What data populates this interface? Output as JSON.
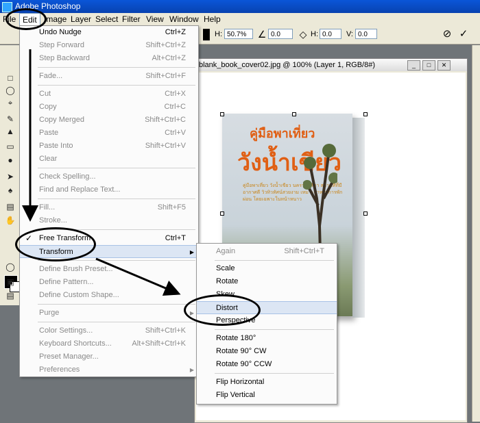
{
  "app": {
    "title": "Adobe Photoshop"
  },
  "menubar": [
    "File",
    "Edit",
    "Image",
    "Layer",
    "Select",
    "Filter",
    "View",
    "Window",
    "Help"
  ],
  "options": {
    "h_label": "H:",
    "h_value": "50.7%",
    "angle_value": "0.0",
    "hskew_label": "H:",
    "hskew_value": "0.0",
    "vskew_label": "V:",
    "vskew_value": "0.0"
  },
  "document": {
    "title": "blank_book_cover02.jpg @ 100% (Layer 1, RGB/8#)"
  },
  "book": {
    "title1": "คู่มือพาเที่ยว",
    "title2": "วังน้ำเขียว",
    "subtitle": "คู่มือพาเที่ยว วังน้ำเขียว นครราชสีมา สถานที่ที่มีอากาศดี วิวทิวทัศน์สวยงาม เหมาะสำหรับการพักผ่อน โดยเฉพาะในหน้าหนาว"
  },
  "edit_menu": [
    {
      "label": "Undo Nudge",
      "shortcut": "Ctrl+Z",
      "disabled": false
    },
    {
      "label": "Step Forward",
      "shortcut": "Shift+Ctrl+Z",
      "disabled": true
    },
    {
      "label": "Step Backward",
      "shortcut": "Alt+Ctrl+Z",
      "disabled": true
    },
    {
      "label": "Fade...",
      "shortcut": "Shift+Ctrl+F",
      "disabled": true
    },
    {
      "label": "Cut",
      "shortcut": "Ctrl+X",
      "disabled": true
    },
    {
      "label": "Copy",
      "shortcut": "Ctrl+C",
      "disabled": true
    },
    {
      "label": "Copy Merged",
      "shortcut": "Shift+Ctrl+C",
      "disabled": true
    },
    {
      "label": "Paste",
      "shortcut": "Ctrl+V",
      "disabled": true
    },
    {
      "label": "Paste Into",
      "shortcut": "Shift+Ctrl+V",
      "disabled": true
    },
    {
      "label": "Clear",
      "shortcut": "",
      "disabled": true
    },
    {
      "label": "Check Spelling...",
      "shortcut": "",
      "disabled": true
    },
    {
      "label": "Find and Replace Text...",
      "shortcut": "",
      "disabled": true
    },
    {
      "label": "Fill...",
      "shortcut": "Shift+F5",
      "disabled": true
    },
    {
      "label": "Stroke...",
      "shortcut": "",
      "disabled": true
    },
    {
      "label": "Free Transform",
      "shortcut": "Ctrl+T",
      "disabled": false,
      "checked": true
    },
    {
      "label": "Transform",
      "shortcut": "",
      "disabled": false,
      "submenu": true
    },
    {
      "label": "Define Brush Preset...",
      "shortcut": "",
      "disabled": true
    },
    {
      "label": "Define Pattern...",
      "shortcut": "",
      "disabled": true
    },
    {
      "label": "Define Custom Shape...",
      "shortcut": "",
      "disabled": true
    },
    {
      "label": "Purge",
      "shortcut": "",
      "disabled": true,
      "submenu": true
    },
    {
      "label": "Color Settings...",
      "shortcut": "Shift+Ctrl+K",
      "disabled": true
    },
    {
      "label": "Keyboard Shortcuts...",
      "shortcut": "Alt+Shift+Ctrl+K",
      "disabled": true
    },
    {
      "label": "Preset Manager...",
      "shortcut": "",
      "disabled": true
    },
    {
      "label": "Preferences",
      "shortcut": "",
      "disabled": true,
      "submenu": true
    }
  ],
  "transform_menu": [
    {
      "label": "Again",
      "shortcut": "Shift+Ctrl+T",
      "disabled": true
    },
    {
      "label": "Scale",
      "shortcut": "",
      "disabled": false
    },
    {
      "label": "Rotate",
      "shortcut": "",
      "disabled": false
    },
    {
      "label": "Skew",
      "shortcut": "",
      "disabled": false
    },
    {
      "label": "Distort",
      "shortcut": "",
      "disabled": false
    },
    {
      "label": "Perspective",
      "shortcut": "",
      "disabled": false
    },
    {
      "label": "Rotate 180°",
      "shortcut": "",
      "disabled": false
    },
    {
      "label": "Rotate 90° CW",
      "shortcut": "",
      "disabled": false
    },
    {
      "label": "Rotate 90° CCW",
      "shortcut": "",
      "disabled": false
    },
    {
      "label": "Flip Horizontal",
      "shortcut": "",
      "disabled": false
    },
    {
      "label": "Flip Vertical",
      "shortcut": "",
      "disabled": false
    }
  ],
  "colors": {
    "accent": "#e05f14",
    "menu_highlight": "#dce6f4"
  }
}
